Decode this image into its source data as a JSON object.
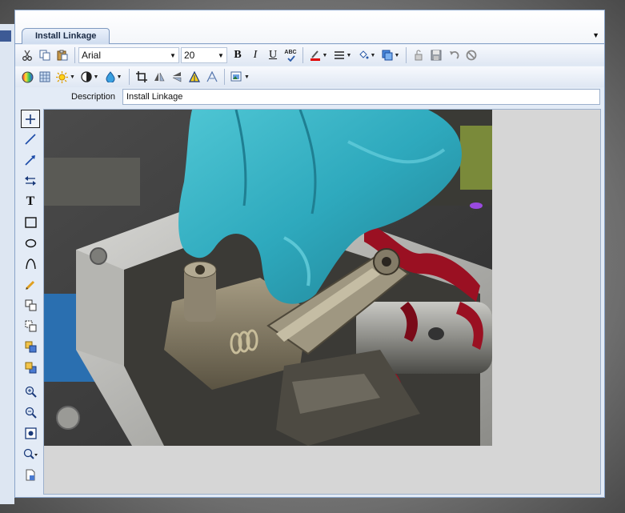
{
  "document": {
    "tab_label": "Install Linkage",
    "tab_menu_icon": "dropdown-arrow"
  },
  "toolbar": {
    "font_family": "Arial",
    "font_size": "20",
    "bold_label": "B",
    "italic_label": "I",
    "underline_label": "U",
    "spell_label": "ABC",
    "icons_row1": [
      "cut-icon",
      "copy-icon",
      "paste-icon",
      "spellcheck-icon",
      "font-color-icon",
      "line-style-icon",
      "fill-color-icon",
      "arrange-icon",
      "lock-icon",
      "save-icon",
      "undo-icon",
      "cancel-icon"
    ],
    "icons_row2": [
      "color-wheel-icon",
      "texture-icon",
      "brightness-icon",
      "contrast-icon",
      "hue-icon",
      "crop-icon",
      "flip-horizontal-icon",
      "flip-vertical-icon",
      "sharpen-icon",
      "blur-icon",
      "image-options-icon"
    ]
  },
  "description": {
    "label": "Description",
    "value": "Install Linkage"
  },
  "tools": [
    "pointer-tool",
    "line-tool",
    "arrow-tool",
    "double-arrow-tool",
    "text-tool",
    "rectangle-tool",
    "ellipse-tool",
    "curve-tool",
    "pencil-tool",
    "group-tool",
    "ungroup-tool",
    "bring-front-tool",
    "send-back-tool",
    "zoom-in-tool",
    "zoom-out-tool",
    "fit-tool",
    "zoom-menu-tool",
    "page-tool"
  ],
  "colors": {
    "accent": "#1a3a7a",
    "window_bg": "#e3ebf6",
    "canvas_bg": "#d6d6d6"
  }
}
